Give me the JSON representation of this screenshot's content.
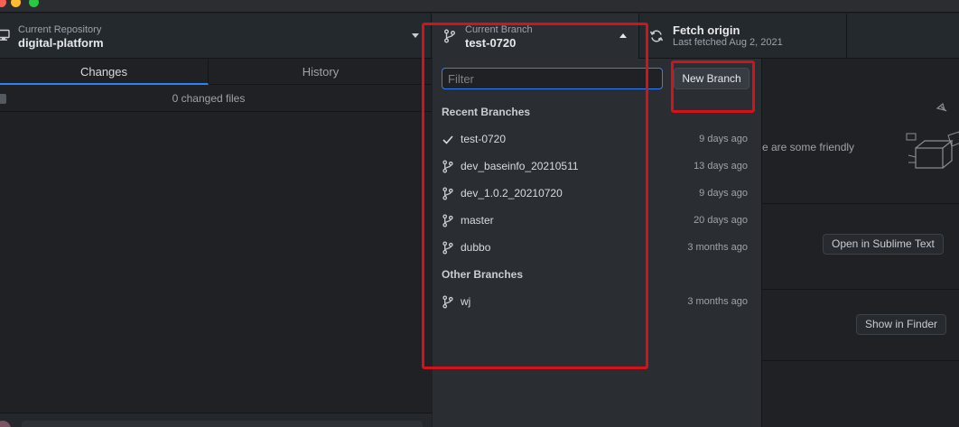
{
  "repository": {
    "caption": "Current Repository",
    "name": "digital-platform"
  },
  "branch_button": {
    "caption": "Current Branch",
    "name": "test-0720"
  },
  "fetch": {
    "title": "Fetch origin",
    "subtitle": "Last fetched Aug 2, 2021"
  },
  "tabs": {
    "changes": "Changes",
    "history": "History"
  },
  "changes": {
    "count_text": "0 changed files"
  },
  "dropdown": {
    "filter_placeholder": "Filter",
    "new_branch_label": "New Branch",
    "recent_header": "Recent Branches",
    "other_header": "Other Branches",
    "recent": [
      {
        "name": "test-0720",
        "age": "9 days ago",
        "icon": "check-icon"
      },
      {
        "name": "dev_baseinfo_20210511",
        "age": "13 days ago",
        "icon": "branch-icon"
      },
      {
        "name": "dev_1.0.2_20210720",
        "age": "9 days ago",
        "icon": "branch-icon"
      },
      {
        "name": "master",
        "age": "20 days ago",
        "icon": "branch-icon"
      },
      {
        "name": "dubbo",
        "age": "3 months ago",
        "icon": "branch-icon"
      }
    ],
    "other": [
      {
        "name": "wj",
        "age": "3 months ago",
        "icon": "branch-icon"
      }
    ]
  },
  "right_panel": {
    "friendly_text": "e are some friendly",
    "open_editor_label": "Open in Sublime Text",
    "show_finder_label": "Show in Finder"
  },
  "colors": {
    "accent": "#2f81f7",
    "annotation": "#d3131c"
  }
}
